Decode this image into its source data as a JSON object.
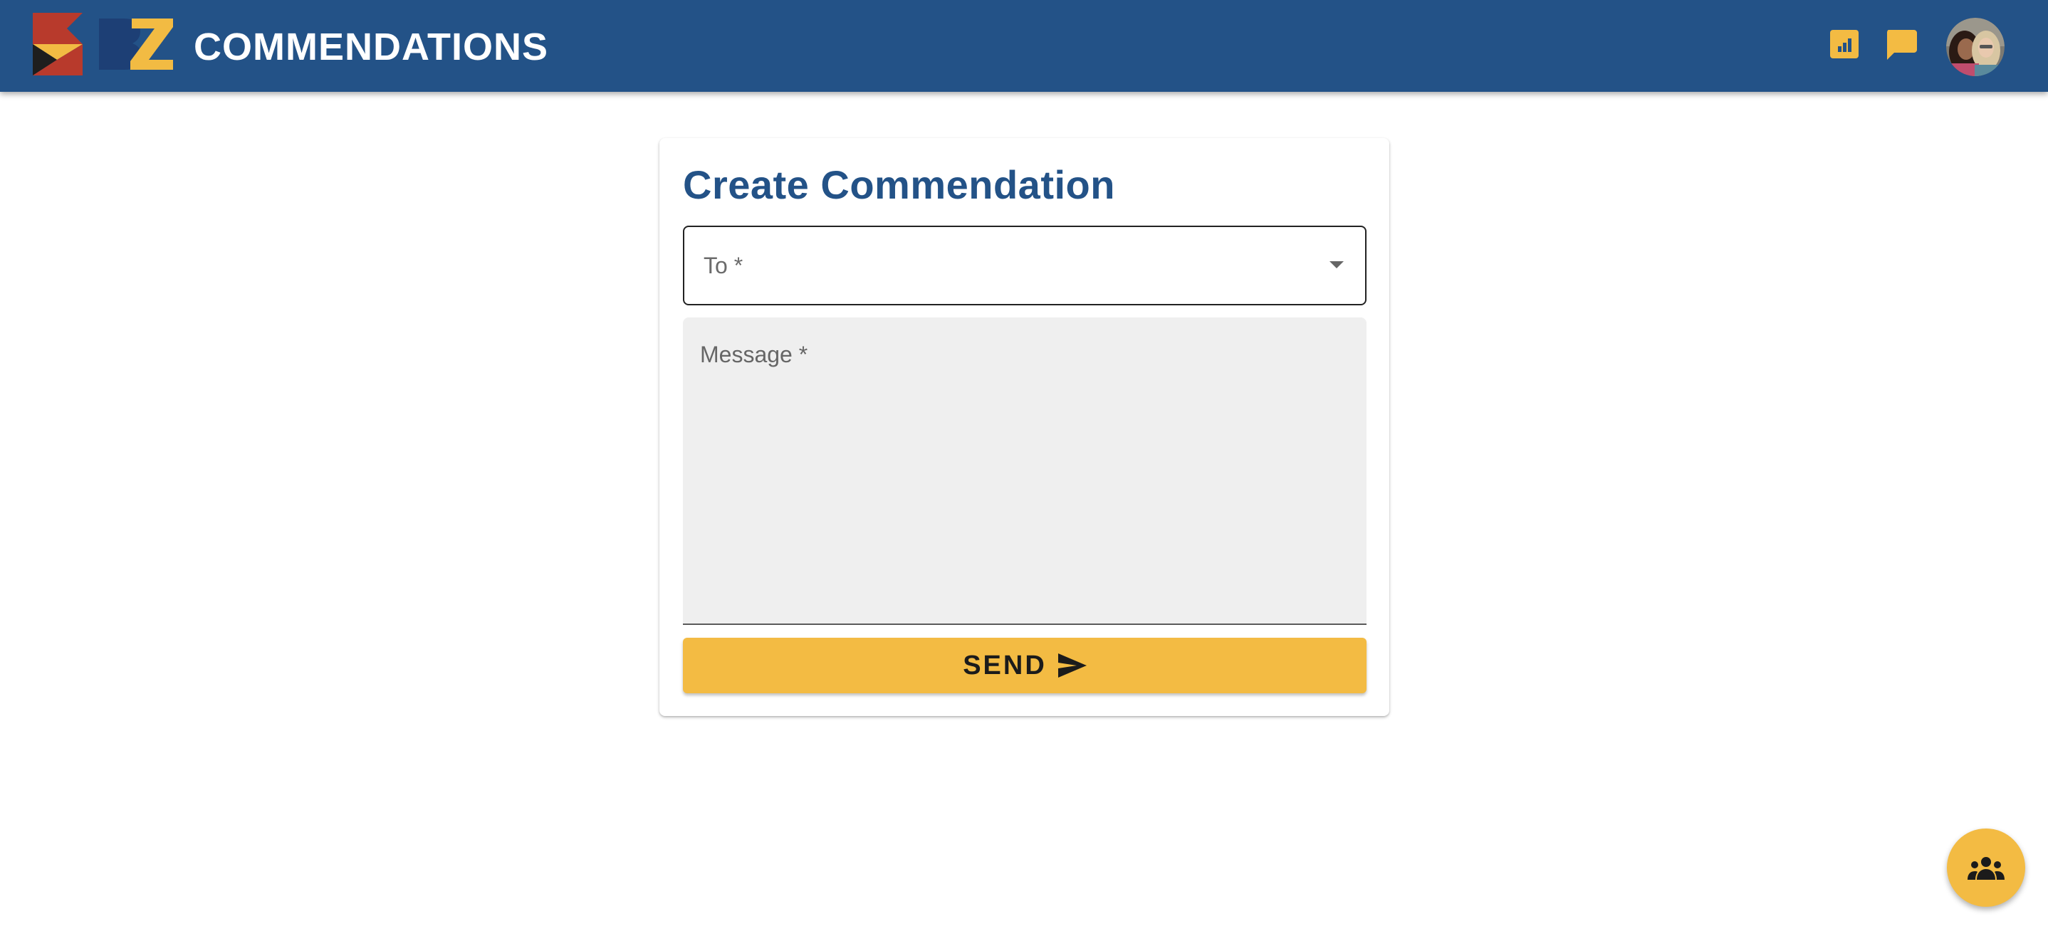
{
  "header": {
    "title": "COMMENDATIONS",
    "logo_icon": "bz-flag-logo-icon",
    "actions": [
      {
        "name": "leaderboard",
        "icon": "leaderboard-chart-icon"
      },
      {
        "name": "messages",
        "icon": "chat-bubble-icon"
      }
    ],
    "avatar_icon": "user-avatar-photo"
  },
  "form": {
    "title": "Create Commendation",
    "to": {
      "label": "To *",
      "value": "",
      "icon": "dropdown-arrow-icon"
    },
    "message": {
      "label": "Message *",
      "value": ""
    },
    "send": {
      "label": "SEND",
      "icon": "send-arrow-icon"
    }
  },
  "fab": {
    "icon": "groups-people-icon"
  },
  "colors": {
    "header_background": "#235287",
    "accent_yellow": "#f3bb43",
    "title_blue": "#235287",
    "field_background": "#efefef"
  }
}
